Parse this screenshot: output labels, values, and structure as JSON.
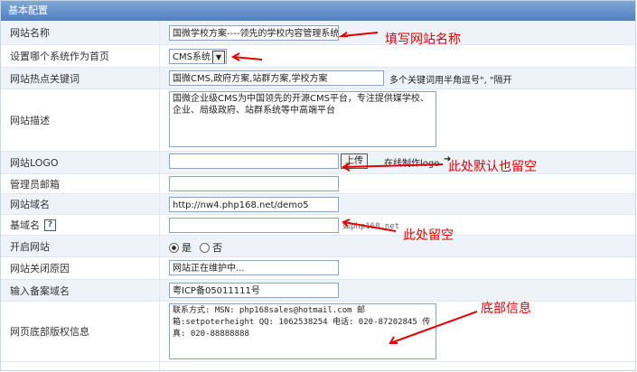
{
  "section": {
    "title": "基本配置"
  },
  "site_name": {
    "label": "网站名称",
    "value": "国微学校方案----领先的学校内容管理系统"
  },
  "home_system": {
    "label": "设置哪个系统作为首页",
    "value": "CMS系统"
  },
  "keywords": {
    "label": "网站热点关键词",
    "value": "国微CMS,政府方案,站群方案,学校方案",
    "hint": "多个关键词用半角逗号\", \"隔开"
  },
  "description": {
    "label": "网站描述",
    "value": "国微企业级CMS为中国领先的开源CMS平台，专注提供媒学校、企业、局级政府、站群系统等中高端平台"
  },
  "logo": {
    "label": "网站LOGO",
    "value": "",
    "upload": "上传",
    "link": "在线制作logo"
  },
  "admin_email": {
    "label": "管理员邮箱",
    "value": ""
  },
  "domain": {
    "label": "网站域名",
    "value": "http://nw4.php168.net/demo5"
  },
  "base_domain": {
    "label": "基域名",
    "value": "",
    "hint": "如php168.net"
  },
  "open": {
    "label": "开启网站",
    "yes": "是",
    "no": "否"
  },
  "close_reason": {
    "label": "网站关闭原因",
    "value": "网站正在维护中..."
  },
  "icp": {
    "label": "输入备案域名",
    "value": "粤ICP备05011111号"
  },
  "footer": {
    "label": "网页底部版权信息",
    "value": "联系方式: MSN: php168sales@hotmail.com 邮箱:setpoterheight QQ: 1062538254 电话: 020-87202845 传真: 020-88888888"
  },
  "annotations": {
    "site_name": "填写网站名称",
    "logo": "此处默认也留空",
    "base_domain": "此处留空",
    "footer": "底部信息"
  }
}
